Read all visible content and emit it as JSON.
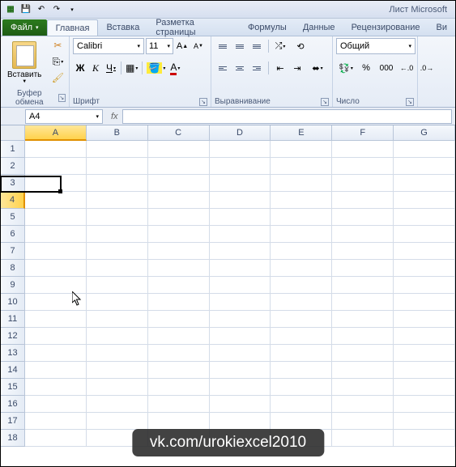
{
  "title": "Лист Microsoft",
  "qat": {
    "save": "💾",
    "undo": "↶",
    "redo": "↷"
  },
  "tabs": {
    "file": "Файл",
    "items": [
      "Главная",
      "Вставка",
      "Разметка страницы",
      "Формулы",
      "Данные",
      "Рецензирование",
      "Ви"
    ],
    "active": 0
  },
  "ribbon": {
    "clipboard": {
      "paste": "Вставить",
      "label": "Буфер обмена"
    },
    "font": {
      "name": "Calibri",
      "size": "11",
      "bold": "Ж",
      "italic": "К",
      "underline": "Ч",
      "label": "Шрифт"
    },
    "alignment": {
      "label": "Выравнивание"
    },
    "number": {
      "format": "Общий",
      "label": "Число"
    }
  },
  "namebox": "A4",
  "columns": [
    "A",
    "B",
    "C",
    "D",
    "E",
    "F",
    "G"
  ],
  "rows": [
    "1",
    "2",
    "3",
    "4",
    "5",
    "6",
    "7",
    "8",
    "9",
    "10",
    "11",
    "12",
    "13",
    "14",
    "15",
    "16",
    "17",
    "18"
  ],
  "active": {
    "col": 0,
    "row": 3
  },
  "watermark": "vk.com/urokiexcel2010"
}
